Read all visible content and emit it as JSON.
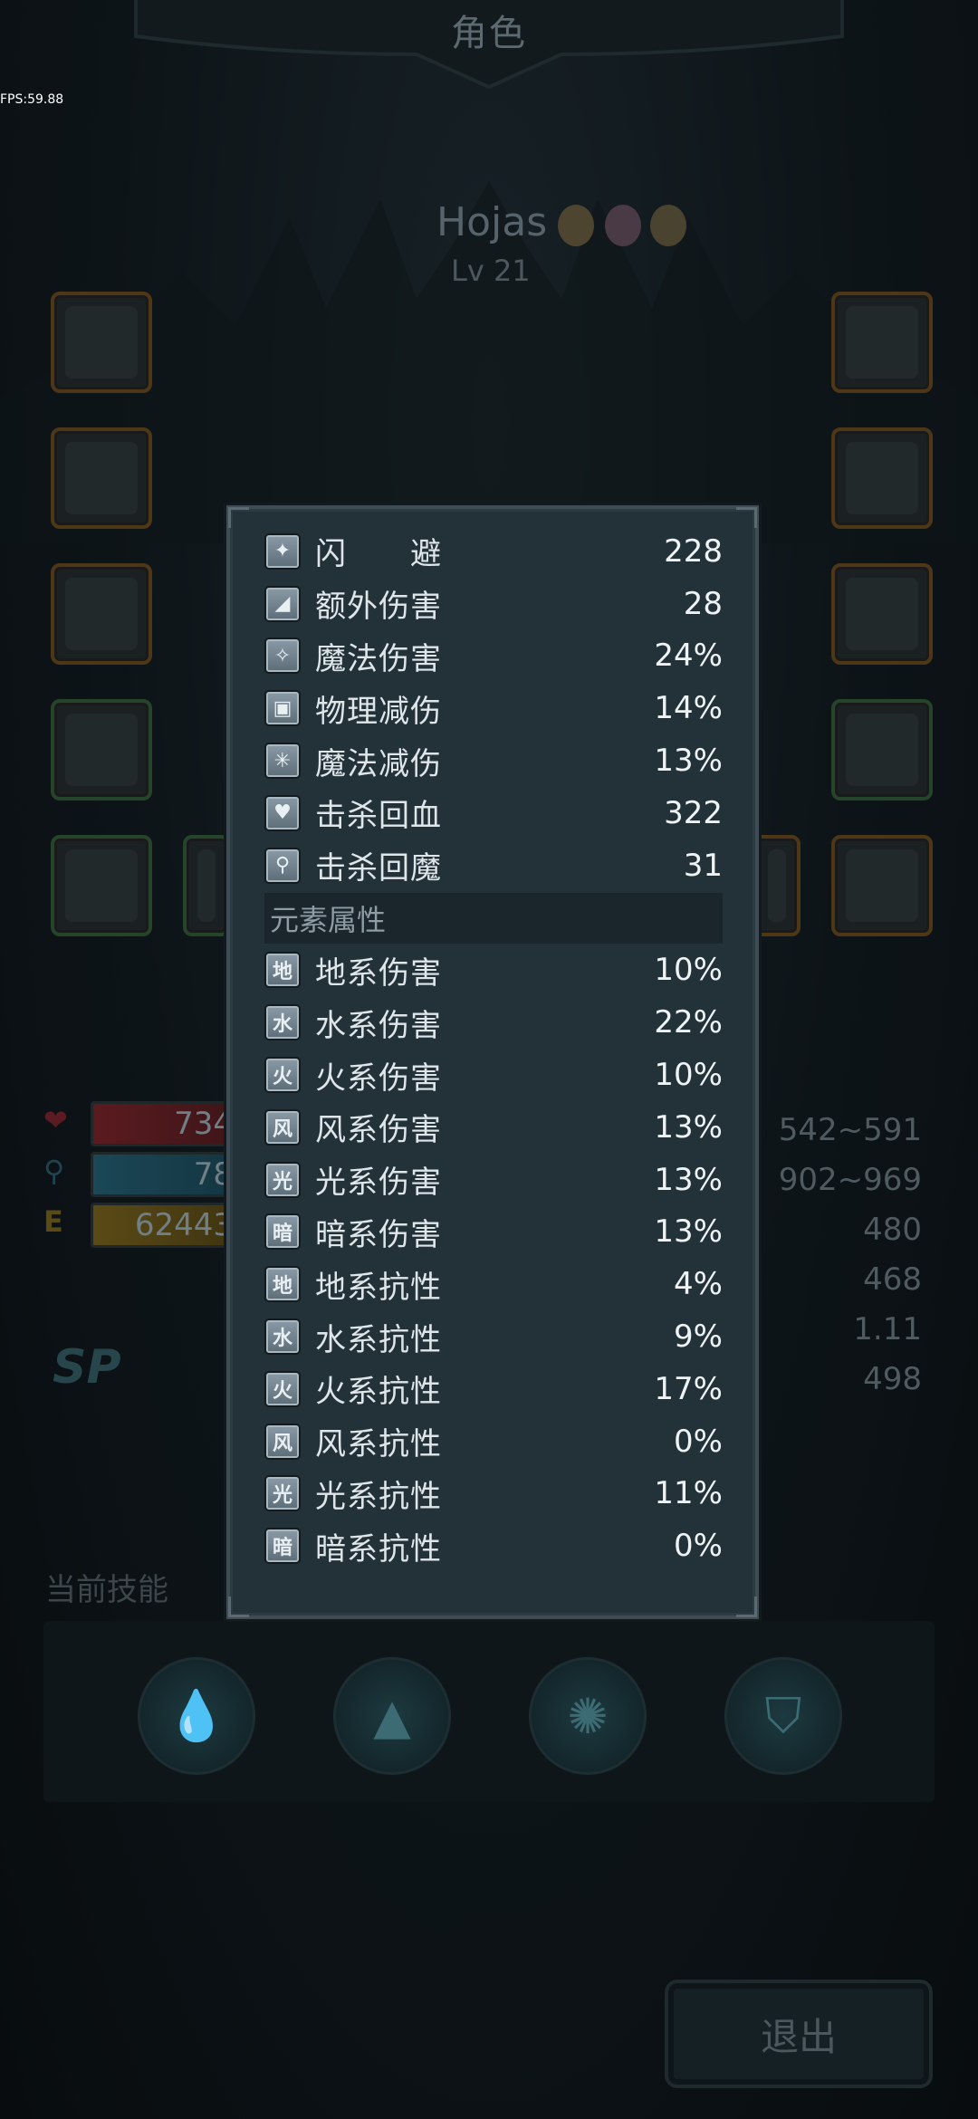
{
  "header": {
    "title": "角色",
    "fps": "FPS:59.88"
  },
  "hero": {
    "name": "Hojas",
    "level": "Lv 21"
  },
  "bars": {
    "hp": "734",
    "mp": "78",
    "exp": "62443"
  },
  "right_stats": [
    "542~591",
    "902~969",
    "480",
    "468",
    "1.11",
    "498"
  ],
  "sp_label": "SP",
  "skills": {
    "label": "当前技能"
  },
  "exit_label": "退出",
  "stats_panel": {
    "rows": [
      {
        "icon": "dodge-icon",
        "glyph": "✦",
        "label": "闪　　避",
        "value": "228"
      },
      {
        "icon": "extra-damage-icon",
        "glyph": "◢",
        "label": "额外伤害",
        "value": "28"
      },
      {
        "icon": "magic-damage-icon",
        "glyph": "✧",
        "label": "魔法伤害",
        "value": "24%"
      },
      {
        "icon": "physical-reduction-icon",
        "glyph": "▣",
        "label": "物理减伤",
        "value": "14%"
      },
      {
        "icon": "magic-reduction-icon",
        "glyph": "✳",
        "label": "魔法减伤",
        "value": "13%"
      },
      {
        "icon": "kill-heal-icon",
        "glyph": "♥",
        "label": "击杀回血",
        "value": "322"
      },
      {
        "icon": "kill-mana-icon",
        "glyph": "⚲",
        "label": "击杀回魔",
        "value": "31"
      }
    ],
    "section_title": "元素属性",
    "element_rows": [
      {
        "icon": "earth-icon",
        "glyph": "地",
        "label": "地系伤害",
        "value": "10%"
      },
      {
        "icon": "water-icon",
        "glyph": "水",
        "label": "水系伤害",
        "value": "22%"
      },
      {
        "icon": "fire-icon",
        "glyph": "火",
        "label": "火系伤害",
        "value": "10%"
      },
      {
        "icon": "wind-icon",
        "glyph": "风",
        "label": "风系伤害",
        "value": "13%"
      },
      {
        "icon": "light-icon",
        "glyph": "光",
        "label": "光系伤害",
        "value": "13%"
      },
      {
        "icon": "dark-icon",
        "glyph": "暗",
        "label": "暗系伤害",
        "value": "13%"
      },
      {
        "icon": "earth-icon",
        "glyph": "地",
        "label": "地系抗性",
        "value": "4%"
      },
      {
        "icon": "water-icon",
        "glyph": "水",
        "label": "水系抗性",
        "value": "9%"
      },
      {
        "icon": "fire-icon",
        "glyph": "火",
        "label": "火系抗性",
        "value": "17%"
      },
      {
        "icon": "wind-icon",
        "glyph": "风",
        "label": "风系抗性",
        "value": "0%"
      },
      {
        "icon": "light-icon",
        "glyph": "光",
        "label": "光系抗性",
        "value": "11%"
      },
      {
        "icon": "dark-icon",
        "glyph": "暗",
        "label": "暗系抗性",
        "value": "0%"
      }
    ]
  }
}
